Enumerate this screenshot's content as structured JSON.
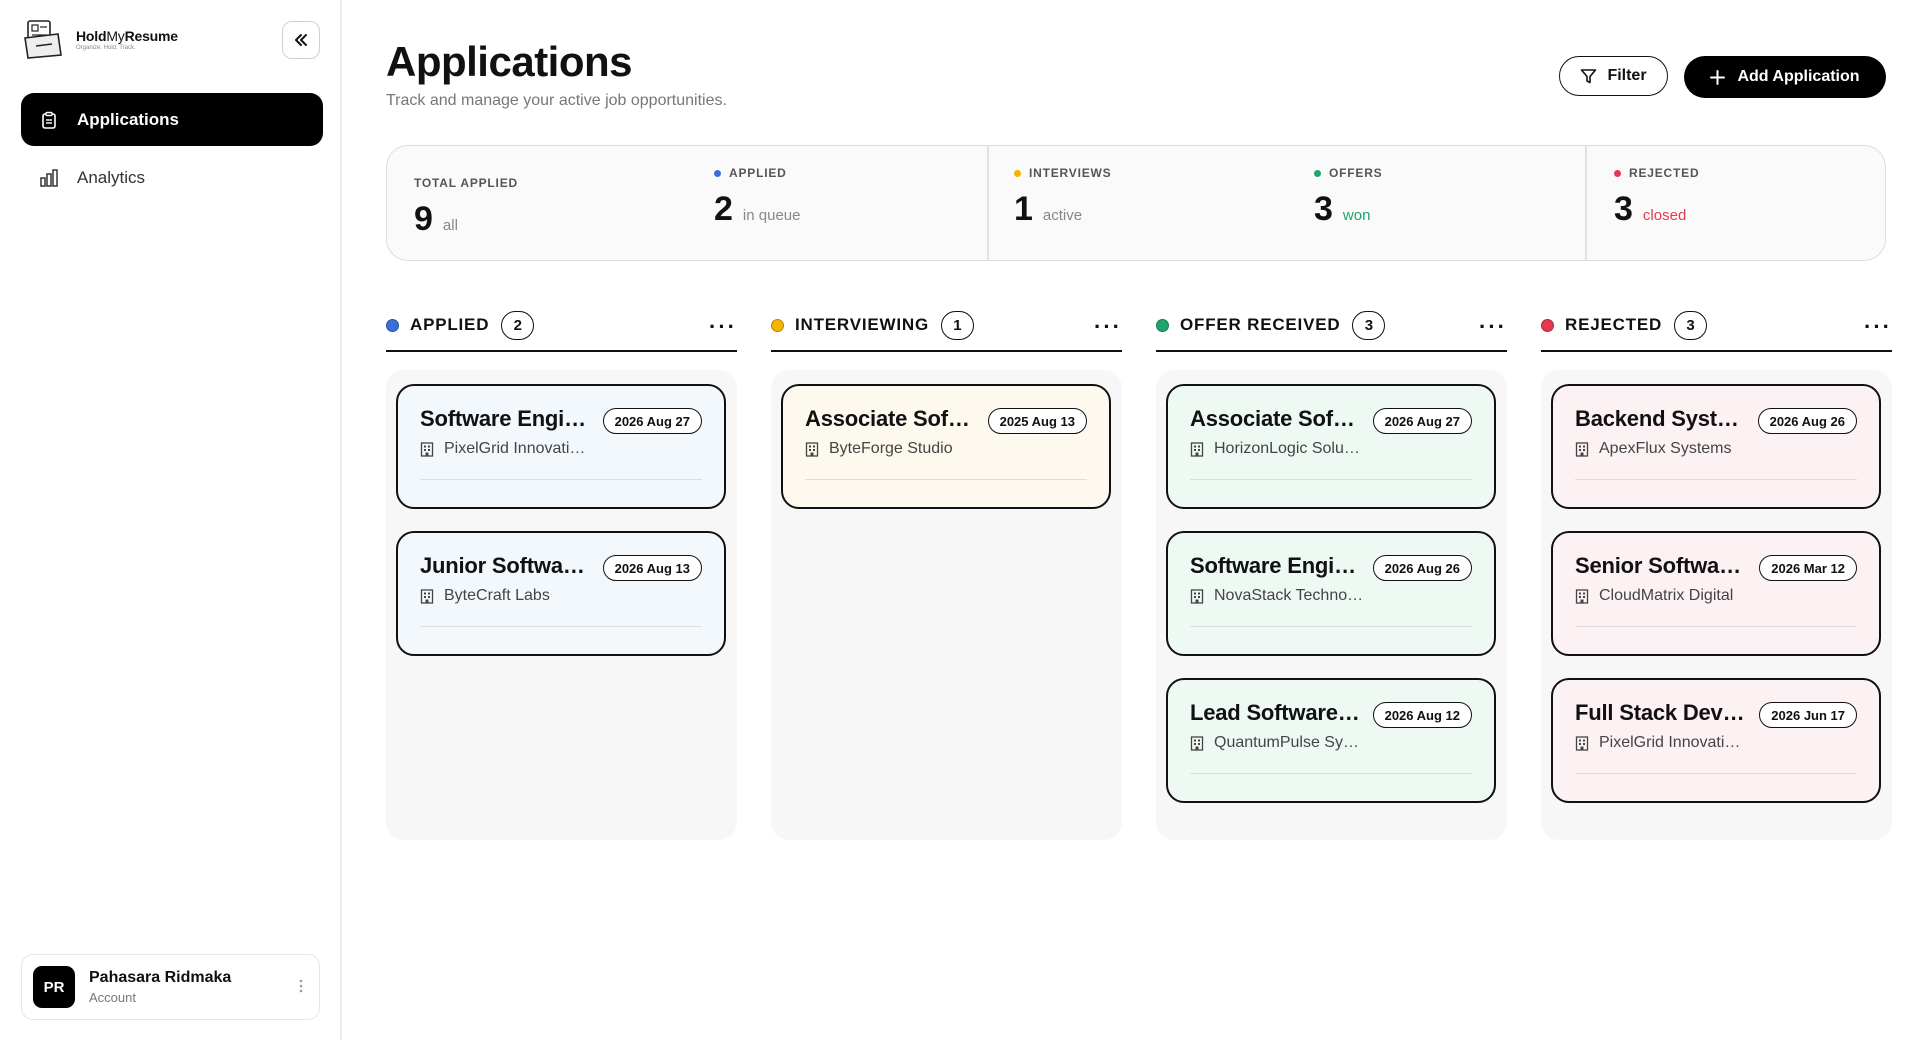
{
  "brand": {
    "name_bold": "Hold",
    "name_light": "My",
    "name_rest": "Resume",
    "tagline": "Organize. Hold. Track."
  },
  "nav": [
    {
      "label": "Applications",
      "icon": "clipboard-icon",
      "active": true
    },
    {
      "label": "Analytics",
      "icon": "bar-chart-icon",
      "active": false
    }
  ],
  "account": {
    "initials": "PR",
    "name": "Pahasara Ridmaka",
    "subtitle": "Account"
  },
  "header": {
    "title": "Applications",
    "subtitle": "Track and manage your active job opportunities.",
    "filter_label": "Filter",
    "add_label": "Add Application"
  },
  "stats": [
    {
      "label": "TOTAL APPLIED",
      "value": "9",
      "unit": "all",
      "dot": "",
      "unit_color": "#888888"
    },
    {
      "label": "APPLIED",
      "value": "2",
      "unit": "in queue",
      "dot": "#3b6fd6",
      "unit_color": "#888888"
    },
    {
      "label": "INTERVIEWS",
      "value": "1",
      "unit": "active",
      "dot": "#f4b400",
      "unit_color": "#888888"
    },
    {
      "label": "OFFERS",
      "value": "3",
      "unit": "won",
      "dot": "#1fa46b",
      "unit_color": "#1fa46b"
    },
    {
      "label": "REJECTED",
      "value": "3",
      "unit": "closed",
      "dot": "#e53950",
      "unit_color": "#e53950"
    }
  ],
  "columns": [
    {
      "title": "APPLIED",
      "count": "2",
      "color": "#3b6fd6",
      "card_bg": "#f3f8fd",
      "cards": [
        {
          "title": "Software Engineer",
          "company": "PixelGrid Innovations",
          "date": "2026 Aug 27"
        },
        {
          "title": "Junior Software Engineer",
          "company": "ByteCraft Labs",
          "date": "2026 Aug 13"
        }
      ]
    },
    {
      "title": "INTERVIEWING",
      "count": "1",
      "color": "#f4b400",
      "card_bg": "#fdf9ee",
      "cards": [
        {
          "title": "Associate Software Engineer",
          "company": "ByteForge Studio",
          "date": "2025 Aug 13"
        }
      ]
    },
    {
      "title": "OFFER RECEIVED",
      "count": "3",
      "color": "#1fa46b",
      "card_bg": "#eff9f3",
      "cards": [
        {
          "title": "Associate Software Engineer",
          "company": "HorizonLogic Solutions",
          "date": "2026 Aug 27"
        },
        {
          "title": "Software Engineer",
          "company": "NovaStack Technologies",
          "date": "2026 Aug 26"
        },
        {
          "title": "Lead Software Engineer",
          "company": "QuantumPulse Systems",
          "date": "2026 Aug 12"
        }
      ]
    },
    {
      "title": "REJECTED",
      "count": "3",
      "color": "#e53950",
      "card_bg": "#fdf2f3",
      "cards": [
        {
          "title": "Backend Systems Engineer",
          "company": "ApexFlux Systems",
          "date": "2026 Aug 26"
        },
        {
          "title": "Senior Software Engineer",
          "company": "CloudMatrix Digital",
          "date": "2026 Mar 12"
        },
        {
          "title": "Full Stack Developer",
          "company": "PixelGrid Innovations",
          "date": "2026 Jun 17"
        }
      ]
    }
  ]
}
